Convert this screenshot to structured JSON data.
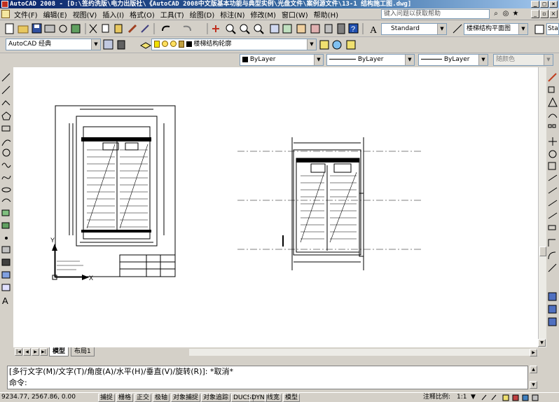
{
  "window": {
    "title": "AutoCAD 2008 - [D:\\签约洗版\\电力出版社\\《AutoCAD 2008中文版基本功能与典型实例\\光盘文件\\案例源文件\\13-1 结构施工图.dwg]"
  },
  "menu": {
    "items": [
      "文件(F)",
      "编辑(E)",
      "视图(V)",
      "插入(I)",
      "格式(O)",
      "工具(T)",
      "绘图(D)",
      "标注(N)",
      "修改(M)",
      "窗口(W)",
      "帮助(H)"
    ],
    "help_placeholder": "键入问题以获取帮助"
  },
  "toolbar": {
    "text_style": "Standard",
    "dim_style": "楼梯结构平面图",
    "extra_style": "Sta"
  },
  "workspace": {
    "name": "AutoCAD 经典"
  },
  "layers": {
    "current": "楼梯结构轮廓"
  },
  "properties": {
    "color": "ByLayer",
    "linetype": "ByLayer",
    "lineweight": "ByLayer",
    "plotstyle": "随颜色"
  },
  "tabs": [
    {
      "label": "模型",
      "active": true
    },
    {
      "label": "布局1",
      "active": false
    }
  ],
  "command": {
    "history": "[多行文字(M)/文字(T)/角度(A)/水平(H)/垂直(V)/旋转(R)]: *取消*",
    "prompt": "命令:"
  },
  "status": {
    "coordinates": "9234.77, 2567.86, 0.00",
    "buttons": [
      "捕捉",
      "栅格",
      "正交",
      "极轴",
      "对象捕捉",
      "对象追踪",
      "DUCS",
      "DYN",
      "线宽",
      "模型"
    ],
    "annotation_scale_label": "注释比例:",
    "annotation_scale": "1:1"
  },
  "drawing": {
    "ucs_x": "X",
    "ucs_y": "Y"
  }
}
